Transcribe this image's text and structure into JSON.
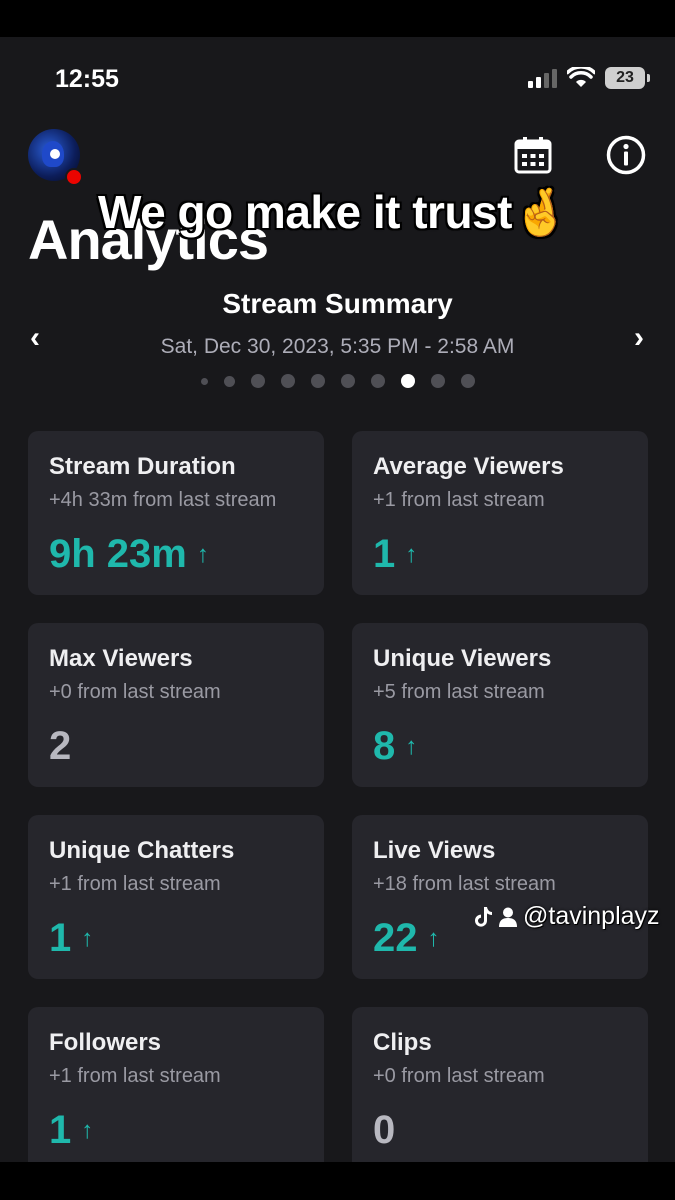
{
  "status": {
    "time": "12:55",
    "battery": "23"
  },
  "header": {
    "title": "Analytics",
    "overlay_caption": "We go make it trust🤞"
  },
  "summary": {
    "title": "Stream Summary",
    "date": "Sat, Dec 30, 2023, 5:35 PM - 2:58 AM",
    "page_count": 10,
    "active_page": 8
  },
  "cards": [
    {
      "title": "Stream Duration",
      "sub": "+4h 33m from last stream",
      "value": "9h 23m",
      "trend": "up"
    },
    {
      "title": "Average Viewers",
      "sub": "+1 from last stream",
      "value": "1",
      "trend": "up"
    },
    {
      "title": "Max Viewers",
      "sub": "+0 from last stream",
      "value": "2",
      "trend": "flat"
    },
    {
      "title": "Unique Viewers",
      "sub": "+5 from last stream",
      "value": "8",
      "trend": "up"
    },
    {
      "title": "Unique Chatters",
      "sub": "+1 from last stream",
      "value": "1",
      "trend": "up"
    },
    {
      "title": "Live Views",
      "sub": "+18 from last stream",
      "value": "22",
      "trend": "up"
    },
    {
      "title": "Followers",
      "sub": "+1 from last stream",
      "value": "1",
      "trend": "up"
    },
    {
      "title": "Clips",
      "sub": "+0 from last stream",
      "value": "0",
      "trend": "flat"
    }
  ],
  "icons": {
    "arrow_up": "↑",
    "prev": "‹",
    "next": "›"
  },
  "watermark": {
    "handle": "@tavinplayz"
  },
  "colors": {
    "accent": "#1fb8ac",
    "background": "#18181b",
    "card": "#26262c",
    "live": "#eb0400"
  }
}
